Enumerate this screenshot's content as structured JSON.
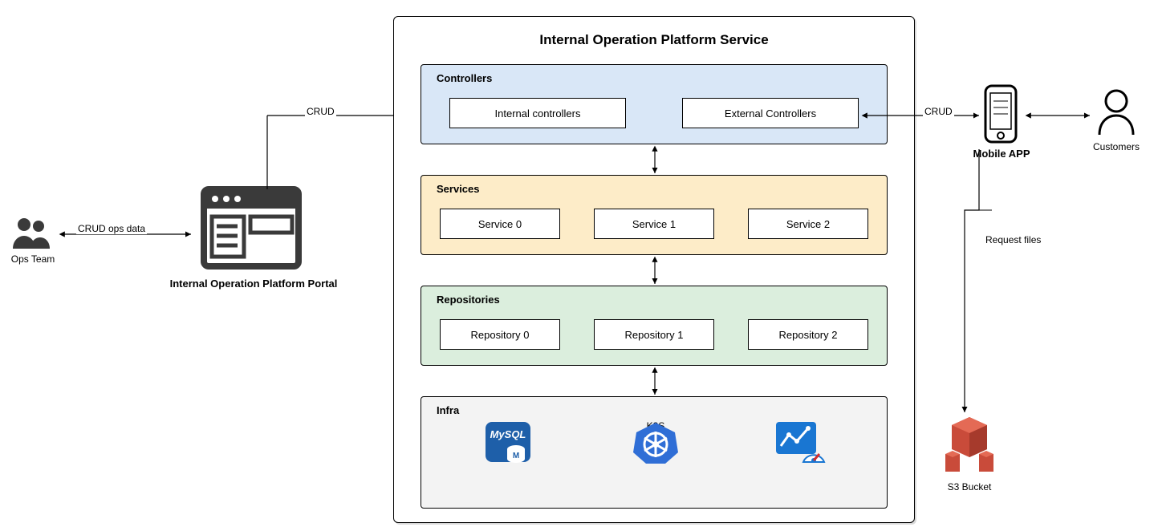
{
  "title": "Internal Operation Platform Service",
  "left": {
    "ops_team": "Ops Team",
    "ops_edge": "CRUD ops data",
    "portal": "Internal Operation Platform Portal",
    "portal_edge": "CRUD"
  },
  "right": {
    "mobile": "Mobile APP",
    "customers": "Customers",
    "crud_edge": "CRUD",
    "req_files": "Request files",
    "s3": "S3 Bucket"
  },
  "layers": {
    "controllers": {
      "title": "Controllers",
      "items": [
        "Internal controllers",
        "External Controllers"
      ]
    },
    "services": {
      "title": "Services",
      "items": [
        "Service 0",
        "Service 1",
        "Service 2"
      ]
    },
    "repos": {
      "title": "Repositories",
      "items": [
        "Repository 0",
        "Repository 1",
        "Repository 2"
      ]
    },
    "infra": {
      "title": "Infra",
      "items": [
        "MySQL",
        "K8S",
        "Monitor"
      ]
    }
  },
  "chart_data": {
    "type": "architecture",
    "actors": [
      {
        "id": "ops",
        "label": "Ops Team"
      },
      {
        "id": "customers",
        "label": "Customers"
      }
    ],
    "nodes": [
      {
        "id": "portal",
        "label": "Internal Operation Platform Portal"
      },
      {
        "id": "service",
        "label": "Internal Operation Platform Service",
        "layers": [
          {
            "name": "Controllers",
            "boxes": [
              "Internal controllers",
              "External Controllers"
            ]
          },
          {
            "name": "Services",
            "boxes": [
              "Service 0",
              "Service 1",
              "Service 2"
            ]
          },
          {
            "name": "Repositories",
            "boxes": [
              "Repository 0",
              "Repository 1",
              "Repository 2"
            ]
          },
          {
            "name": "Infra",
            "boxes": [
              "MySQL",
              "K8S",
              "Monitor"
            ]
          }
        ]
      },
      {
        "id": "mobile",
        "label": "Mobile APP"
      },
      {
        "id": "s3",
        "label": "S3 Bucket"
      }
    ],
    "edges": [
      {
        "from": "ops",
        "to": "portal",
        "label": "CRUD ops data",
        "dir": "both"
      },
      {
        "from": "portal",
        "to": "service.Controllers.Internal controllers",
        "label": "CRUD",
        "dir": "forward-elbow"
      },
      {
        "from": "mobile",
        "to": "service.Controllers.External Controllers",
        "label": "CRUD",
        "dir": "both"
      },
      {
        "from": "mobile",
        "to": "customers",
        "dir": "both"
      },
      {
        "from": "mobile",
        "to": "s3",
        "label": "Request files",
        "dir": "forward"
      },
      {
        "from": "service.Controllers",
        "to": "service.Services",
        "dir": "both"
      },
      {
        "from": "service.Services",
        "to": "service.Repositories",
        "dir": "both"
      },
      {
        "from": "service.Repositories",
        "to": "service.Infra",
        "dir": "both"
      }
    ]
  }
}
